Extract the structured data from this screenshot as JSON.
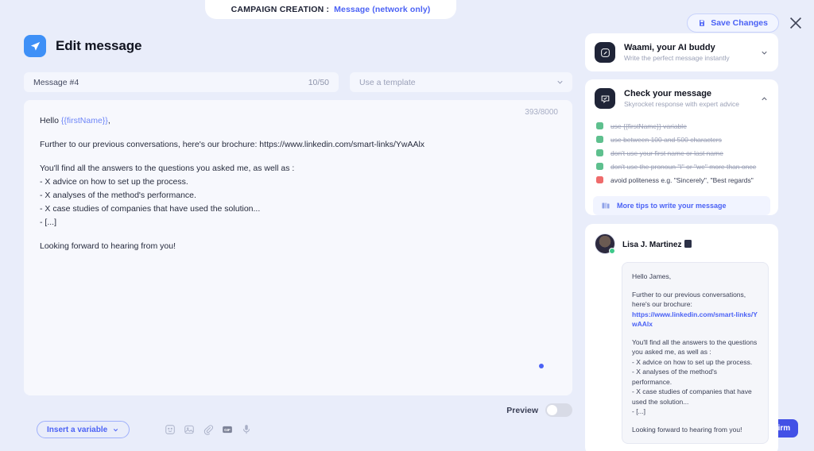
{
  "top_tab": {
    "label": "CAMPAIGN CREATION :",
    "value": "Message (network only)"
  },
  "header": {
    "save_label": "Save Changes",
    "save_icon": "save-icon",
    "close_icon": "close-icon"
  },
  "editor": {
    "app_icon": "send-paper-plane-icon",
    "title": "Edit message",
    "message_name": "Message #4",
    "message_name_counter": "10/50",
    "template_placeholder": "Use a template",
    "template_chevron": "chevron-down-icon",
    "char_counter": "393/8000",
    "body": {
      "greeting_prefix": "Hello ",
      "greeting_variable": "{{firstName}}",
      "greeting_suffix": ",",
      "paragraph_2": "Further to our previous conversations, here's our brochure: https://www.linkedin.com/smart-links/YwAAlx",
      "paragraph_3_line1": "You'll find all the answers to the questions you asked me, as well as :",
      "paragraph_3_line2": "- X advice on how to set up the process.",
      "paragraph_3_line3": "- X analyses of the method's performance.",
      "paragraph_3_line4": "- X case studies of companies that have used the solution...",
      "paragraph_3_line5": "- [...]",
      "paragraph_4": "Looking forward to hearing from you!"
    },
    "preview_toggle_label": "Preview",
    "preview_toggle_state": "off"
  },
  "bottom_bar": {
    "insert_variable_label": "Insert a variable",
    "insert_variable_chevron": "chevron-down-icon",
    "tools": [
      {
        "name": "emoji-icon"
      },
      {
        "name": "image-icon"
      },
      {
        "name": "attachment-paperclip-icon"
      },
      {
        "name": "gif-icon"
      },
      {
        "name": "microphone-icon"
      }
    ],
    "confirm_label": "Confirm"
  },
  "sidebar": {
    "waami_panel": {
      "icon": "pencil-square-icon",
      "title": "Waami, your AI buddy",
      "subtitle": "Write the perfect message instantly",
      "chevron": "chevron-down-icon",
      "expanded": false
    },
    "check_panel": {
      "icon": "speech-bubble-check-icon",
      "title": "Check your message",
      "subtitle": "Skyrocket response with expert advice",
      "chevron": "chevron-up-icon",
      "expanded": true,
      "items": [
        {
          "text": "use {{firstName}} variable",
          "status": "ok"
        },
        {
          "text": "use between 100 and 500 characters",
          "status": "ok"
        },
        {
          "text": "don't use your first name or last name",
          "status": "ok"
        },
        {
          "text": "don't use the pronoun \"I\" or \"we\" more than once",
          "status": "ok"
        },
        {
          "text": "avoid politeness e.g. \"Sincerely\", \"Best regards\"",
          "status": "bad"
        }
      ],
      "tips_label": "More tips to write your message",
      "tips_icon": "books-icon"
    },
    "preview_card": {
      "avatar": "user-avatar",
      "name": "Lisa J. Martinez",
      "badge_icon": "linkedin-badge-icon",
      "online_status": "online",
      "message": {
        "greeting": "Hello James,",
        "paragraph_2_text": "Further to our previous conversations, here's our brochure:",
        "paragraph_2_link": "https://www.linkedin.com/smart-links/YwAAlx",
        "paragraph_3_line1": "You'll find all the answers to the questions you asked me, as well as :",
        "paragraph_3_line2": "- X advice on how to set up the process.",
        "paragraph_3_line3": "- X analyses of the method's performance.",
        "paragraph_3_line4": "- X case studies of companies that have used the solution...",
        "paragraph_3_line5": "- [...]",
        "paragraph_4": "Looking forward to hearing from you!"
      }
    }
  }
}
